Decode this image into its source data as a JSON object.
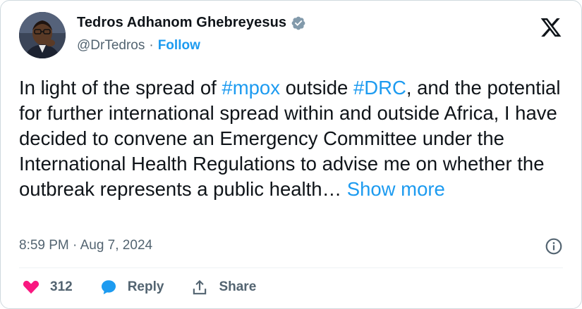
{
  "author": {
    "display_name": "Tedros Adhanom Ghebreyesus",
    "handle": "@DrTedros",
    "separator": "·",
    "follow_label": "Follow",
    "verified": true
  },
  "tweet": {
    "text_1": "In light of the spread of ",
    "hashtag_1": "#mpox",
    "text_2": " outside ",
    "hashtag_2": "#DRC",
    "text_3": ", and the potential for further international spread within and outside Africa, I have decided to convene an Emergency Committee under the International Health Regulations to advise me on whether the outbreak represents a public health… ",
    "show_more_label": "Show more"
  },
  "meta": {
    "timestamp": "8:59 PM · Aug 7, 2024"
  },
  "actions": {
    "like_count": "312",
    "reply_label": "Reply",
    "share_label": "Share"
  },
  "icons": {
    "brand": "x-logo-icon",
    "verified": "verified-badge-icon",
    "info": "info-icon",
    "like": "heart-icon",
    "reply": "reply-bubble-icon",
    "share": "share-icon"
  },
  "colors": {
    "link": "#1d9bf0",
    "text": "#0f1419",
    "muted": "#536471",
    "like": "#f91880",
    "verified_badge": "#829aab",
    "border": "#cfd9de"
  }
}
